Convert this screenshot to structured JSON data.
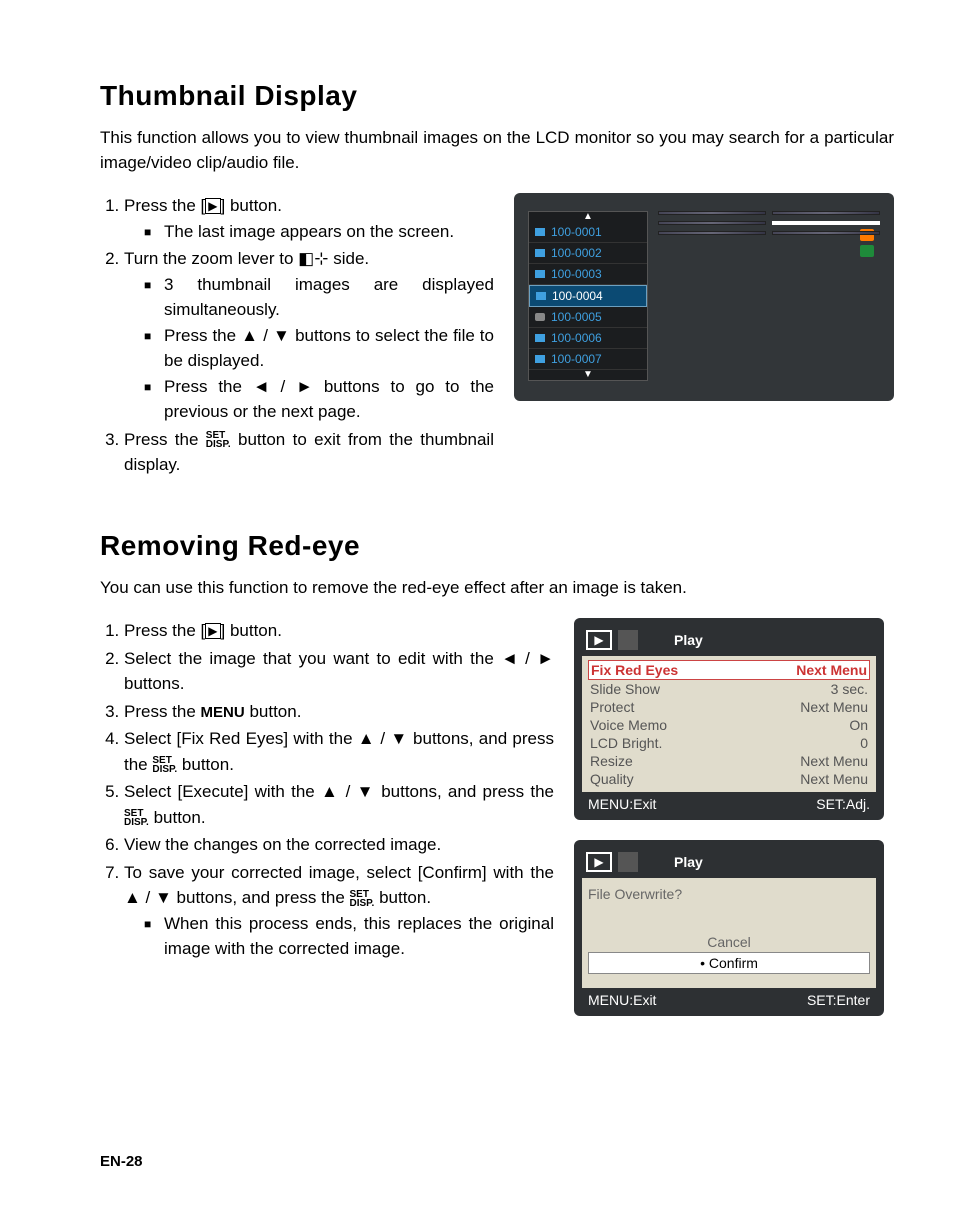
{
  "section1": {
    "title": "Thumbnail Display",
    "intro": "This function allows you to view thumbnail images on the LCD monitor so you may search for a particular image/video clip/audio file.",
    "steps": {
      "s1a": "Press the [",
      "s1b": "] button.",
      "s1_sub1": "The last image appears on the screen.",
      "s2a": "Turn the zoom lever to ",
      "s2b": " side.",
      "s2_sub1": "3 thumbnail images are displayed simultaneously.",
      "s2_sub2a": "Press the ",
      "s2_sub2b": " buttons to select the file to be displayed.",
      "s2_sub3a": "Press the ",
      "s2_sub3b": " buttons to go to the previous or the next page.",
      "s3a": "Press the ",
      "s3b": " button to exit from the thumbnail display."
    },
    "thumbs": {
      "items": [
        "100-0001",
        "100-0002",
        "100-0003",
        "100-0004",
        "100-0005",
        "100-0006",
        "100-0007"
      ]
    }
  },
  "section2": {
    "title": "Removing Red-eye",
    "intro": "You can use this function to remove the red-eye effect after an image is taken.",
    "steps": {
      "s1a": "Press the [",
      "s1b": "] button.",
      "s2": "Select the image that you want to edit with the ◄ / ► buttons.",
      "s3": "Press the MENU button.",
      "s4a": "Select [Fix Red Eyes] with the ",
      "s4b": " buttons, and press the ",
      "s4c": " button.",
      "s5a": "Select [Execute] with the ",
      "s5b": " buttons, and press the ",
      "s5c": " button.",
      "s6": "View the changes on the corrected image.",
      "s7a": "To save your corrected image, select [Confirm] with the ",
      "s7b": " buttons, and press the ",
      "s7c": " button.",
      "s7_sub1": "When this process ends, this replaces the original image with the corrected image."
    }
  },
  "menu1": {
    "title": "Play",
    "rows": [
      {
        "l": "Fix Red Eyes",
        "r": "Next Menu",
        "sel": true
      },
      {
        "l": "Slide Show",
        "r": "3 sec."
      },
      {
        "l": "Protect",
        "r": "Next Menu"
      },
      {
        "l": "Voice Memo",
        "r": "On"
      },
      {
        "l": "LCD Bright.",
        "r": "0"
      },
      {
        "l": "Resize",
        "r": "Next Menu"
      },
      {
        "l": "Quality",
        "r": "Next Menu"
      }
    ],
    "foot_l": "MENU:Exit",
    "foot_r": "SET:Adj."
  },
  "menu2": {
    "title": "Play",
    "question": "File Overwrite?",
    "opts": [
      {
        "t": "Cancel"
      },
      {
        "t": "• Confirm",
        "sel": true
      }
    ],
    "foot_l": "MENU:Exit",
    "foot_r": "SET:Enter"
  },
  "footer": "EN-28",
  "glyphs": {
    "play_icon": "▶",
    "wide_icon": "◧⊹",
    "up": "▲",
    "down": "▼",
    "left": "◄",
    "right": "►",
    "updown": "▲ / ▼",
    "leftright": "◄ / ►",
    "set_top": "SET",
    "set_bot": "DISP.",
    "menu": "MENU"
  }
}
